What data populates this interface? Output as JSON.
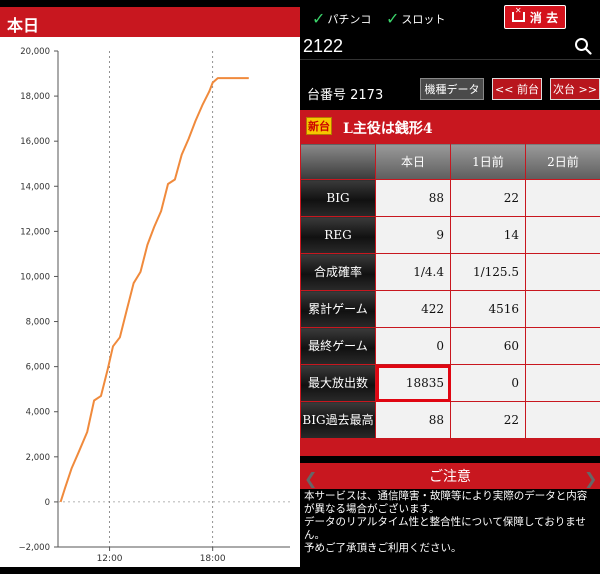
{
  "chart_panel": {
    "title": "本日"
  },
  "chart_data": {
    "type": "line",
    "title": "本日",
    "xlabel": "",
    "ylabel": "",
    "ylim": [
      -2000,
      20000
    ],
    "yticks": [
      "20,000",
      "18,000",
      "16,000",
      "14,000",
      "12,000",
      "10,000",
      "8,000",
      "6,000",
      "4,000",
      "2,000",
      "0",
      "−2,000"
    ],
    "ytick_values": [
      20000,
      18000,
      16000,
      14000,
      12000,
      10000,
      8000,
      6000,
      4000,
      2000,
      0,
      -2000
    ],
    "xticks": [
      "12:00",
      "18:00"
    ],
    "xtick_hours": [
      12,
      18
    ],
    "xlim_hours": [
      9,
      22.5
    ],
    "grid": true,
    "color": "#f08a3c",
    "series": [
      {
        "x": [
          9.15,
          9.4,
          9.8,
          10.2,
          10.7,
          11.1,
          11.5,
          11.9,
          12.2,
          12.6,
          13.0,
          13.4,
          13.8,
          14.2,
          14.6,
          15.0,
          15.4,
          15.8,
          16.2,
          16.6,
          17.0,
          17.4,
          17.8,
          18.0,
          18.3,
          18.6,
          19.0,
          19.2,
          20.1
        ],
        "y": [
          0,
          600,
          1500,
          2200,
          3100,
          4500,
          4700,
          5900,
          6900,
          7300,
          8500,
          9700,
          10200,
          11400,
          12200,
          12900,
          14100,
          14300,
          15400,
          16100,
          16900,
          17600,
          18200,
          18600,
          18800,
          18800,
          18800,
          18800,
          18800
        ]
      }
    ]
  },
  "toolbar": {
    "pachinko": "パチンコ",
    "slot": "スロット",
    "clear_label": "消 去"
  },
  "search": {
    "value": "2122"
  },
  "machine": {
    "number_label": "台番号 2173",
    "model_data_btn": "機種データ",
    "prev_btn": "<< 前台",
    "next_btn": "次台 >>",
    "new_badge": "新台",
    "name": "L主役は銭形4"
  },
  "table": {
    "headers": [
      "本日",
      "1日前",
      "2日前"
    ],
    "rows": [
      {
        "label": "BIG",
        "today": "88",
        "d1": "22",
        "d2": ""
      },
      {
        "label": "REG",
        "today": "9",
        "d1": "14",
        "d2": ""
      },
      {
        "label": "合成確率",
        "today": "1/4.4",
        "d1": "1/125.5",
        "d2": ""
      },
      {
        "label": "累計ゲーム",
        "today": "422",
        "d1": "4516",
        "d2": ""
      },
      {
        "label": "最終ゲーム",
        "today": "0",
        "d1": "60",
        "d2": ""
      },
      {
        "label": "最大放出数",
        "today": "18835",
        "d1": "0",
        "d2": ""
      },
      {
        "label": "BIG過去最高",
        "today": "88",
        "d1": "22",
        "d2": ""
      }
    ]
  },
  "notice": {
    "title": "ご注意",
    "lines": [
      "本サービスは、通信障害・故障等により実際のデータと内容が異なる場合がございます。",
      "データのリアルタイム性と整合性について保障しておりません。",
      "予めご了承頂きご利用ください。"
    ]
  }
}
